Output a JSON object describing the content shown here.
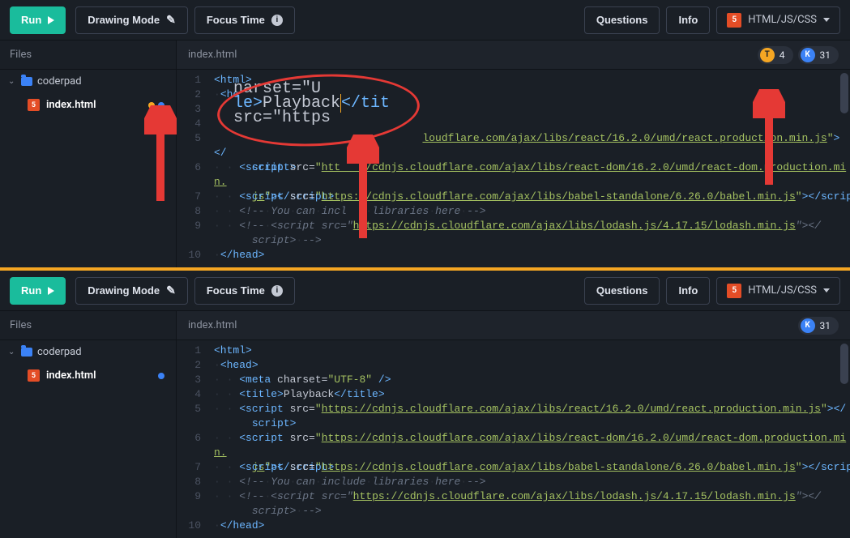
{
  "toolbar": {
    "run": "Run",
    "drawing_mode": "Drawing Mode",
    "focus_time": "Focus Time",
    "questions": "Questions",
    "info": "Info",
    "language": "HTML/JS/CSS"
  },
  "files": {
    "header": "Files",
    "folder": "coderpad",
    "file": "index.html"
  },
  "editor": {
    "filename": "index.html",
    "badges": {
      "t_letter": "T",
      "t_count": "4",
      "k_letter": "K",
      "k_count": "31"
    },
    "zoom": {
      "l1": "narset=\"U",
      "l2a": "le>",
      "l2b": "Playback",
      "l2c": "</tit",
      "l3": " src=\"https"
    },
    "code": {
      "urls": {
        "react": "loudflare.com/ajax/libs/react/16.2.0/umd/react.production.min.js",
        "react_full": "https://cdnjs.cloudflare.com/ajax/libs/react/16.2.0/umd/react.production.min.js",
        "react_dom": "https://cdnjs.cloudflare.com/ajax/libs/react-dom/16.2.0/umd/react-dom.production.min.js",
        "babel": "https://cdnjs.cloudflare.com/ajax/libs/babel-standalone/6.26.0/babel.min.js",
        "lodash": "https://cdnjs.cloudflare.com/ajax/libs/lodash.js/4.17.15/lodash.min.js"
      },
      "comment1": "<!-- You can include libraries here -->",
      "meta_attr": "charset",
      "meta_val": "\"UTF-8\"",
      "title_text": "Playback"
    }
  }
}
